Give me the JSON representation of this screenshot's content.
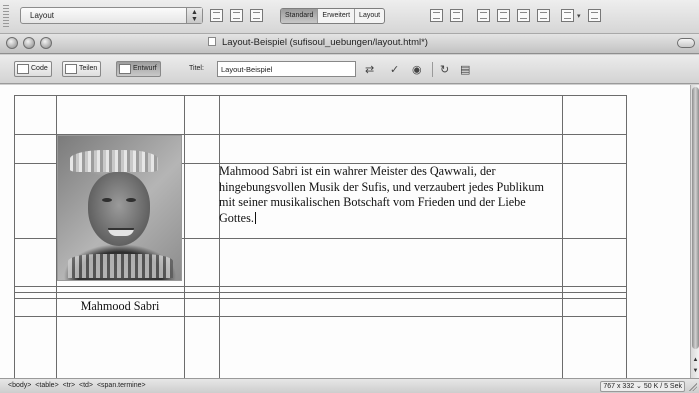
{
  "insert_bar": {
    "category_select": "Layout",
    "mode_buttons": [
      "Standard",
      "Erweitert",
      "Layout"
    ],
    "active_mode": "Standard"
  },
  "window": {
    "title": "Layout-Beispiel (sufisoul_uebungen/layout.html*)"
  },
  "doc_toolbar": {
    "view_buttons": [
      "Code",
      "Teilen",
      "Entwurf"
    ],
    "active_view": "Entwurf",
    "title_label": "Titel:",
    "title_value": "Layout-Beispiel"
  },
  "content": {
    "paragraph": "Mahmood Sabri ist ein wahrer Meister des Qawwali, der hingebungsvollen Musik der Sufis, und verzaubert jedes Publikum mit seiner musikalischen Botschaft vom Frieden und der Liebe Gottes.",
    "caption": "Mahmood Sabri"
  },
  "status_bar": {
    "tag_path": "<body> <table> <tr> <td> <span.termine>",
    "size_info": "767 x 332 ⌄ 50 K / 5 Sek"
  }
}
